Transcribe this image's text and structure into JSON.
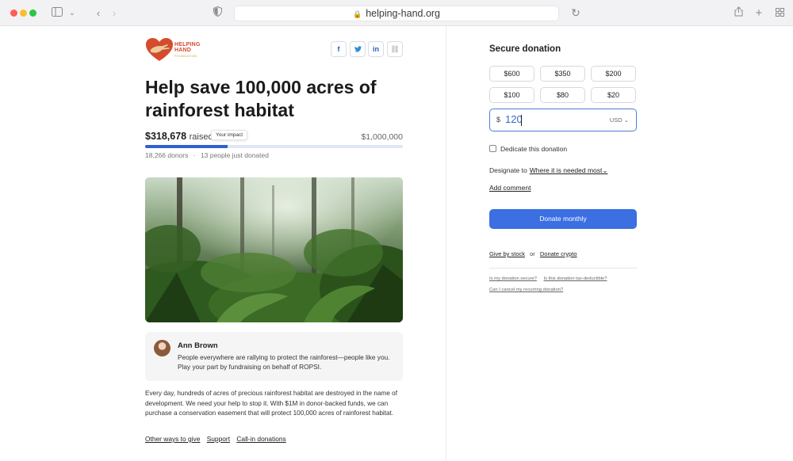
{
  "browser": {
    "url": "helping-hand.org"
  },
  "brand": {
    "name_line1": "HELPING",
    "name_line2": "HAND",
    "name_line3": "FOUNDATION"
  },
  "share": {
    "facebook": "f",
    "twitter": "t",
    "linkedin": "in",
    "link": "⛓"
  },
  "campaign": {
    "title": "Help save 100,000 acres of rainforest habitat",
    "raised_amount": "$318,678",
    "raised_label": "raised",
    "impact_tooltip": "Your impact",
    "goal": "$1,000,000",
    "progress_fraction": 0.32,
    "donors": "18,266 donors",
    "separator": "·",
    "recent": "13 people just donated"
  },
  "quote": {
    "name": "Ann Brown",
    "text": "People everywhere are rallying to protect the rainforest—people like you. Play your part by fundraising on behalf of ROPSI."
  },
  "description": "Every day, hundreds of acres of precious rainforest habitat are destroyed in the name of development. We need your help to stop it. With $1M in donor-backed funds, we can purchase a conservation easement that will protect 100,000 acres of rainforest habitat.",
  "footer_links": [
    "Other ways to give",
    "Support",
    "Call-in donations"
  ],
  "donation": {
    "title": "Secure donation",
    "amounts": [
      "$600",
      "$350",
      "$200",
      "$100",
      "$80",
      "$20"
    ],
    "currency_symbol": "$",
    "amount_value": "120",
    "currency_code": "USD ⌄",
    "dedicate_label": "Dedicate this donation",
    "designate_label": "Designate to",
    "designate_value": "Where it is needed most⌄",
    "add_comment": "Add comment",
    "donate_button": "Donate monthly",
    "give_by_stock": "Give by stock",
    "or": "or",
    "donate_crypto": "Donate crypto",
    "faq": [
      "Is my donation secure?",
      "Is this donation tax-deductible?",
      "Can I cancel my recurring donation?"
    ]
  },
  "colors": {
    "accent": "#3b6fe2",
    "progress": "#2f5fd1",
    "brand_red": "#d64a2f"
  }
}
